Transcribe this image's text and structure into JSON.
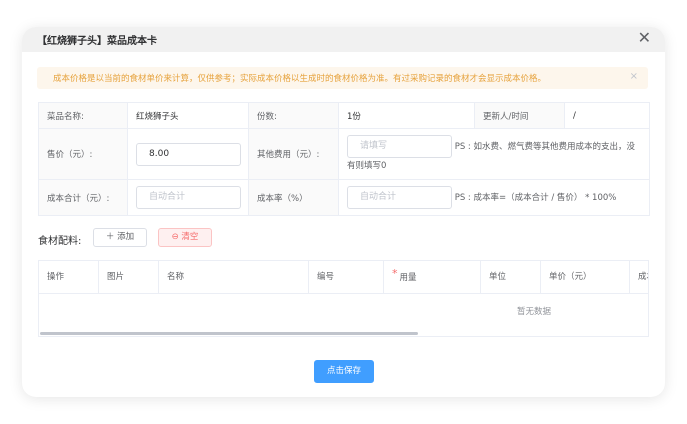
{
  "dialog": {
    "title": "【红烧狮子头】菜品成本卡",
    "close_glyph": "✕"
  },
  "alert": {
    "text": "成本价格是以当前的食材单价来计算，仅供参考；实际成本价格以生成时的食材价格为准。有过采购记录的食材才会显示成本价格。",
    "close_glyph": "×"
  },
  "info": {
    "dish_name_label": "菜品名称:",
    "dish_name_value": "红烧狮子头",
    "portion_label": "份数:",
    "portion_value": "1份",
    "updater_label": "更新人/时间",
    "updater_value": "/",
    "price_label": "售价（元）:",
    "price_value": "8.00",
    "other_cost_label": "其他费用（元）:",
    "other_cost_placeholder": "请填写",
    "other_cost_note": "PS : 如水费、燃气费等其他费用成本的支出，没有则填写0",
    "cost_total_label": "成本合计（元）:",
    "cost_total_placeholder": "自动合计",
    "cost_rate_label": "成本率（%）",
    "cost_rate_placeholder": "自动合计",
    "cost_rate_note": "PS : 成本率=（成本合计 / 售价） * 100%"
  },
  "ingredients": {
    "label": "食材配料:",
    "add_label": "＋ 添加",
    "clear_label": "⊖ 清空",
    "columns": [
      "操作",
      "图片",
      "名称",
      "编号",
      "用量",
      "单位",
      "单价（元）",
      "成本"
    ],
    "required_mark": "*",
    "empty_text": "暂无数据"
  },
  "footer": {
    "save_label": "点击保存"
  },
  "colors": {
    "primary": "#409eff",
    "warning_text": "#e6a23c",
    "warning_bg": "#fdf6ec",
    "danger": "#f56c6c"
  }
}
